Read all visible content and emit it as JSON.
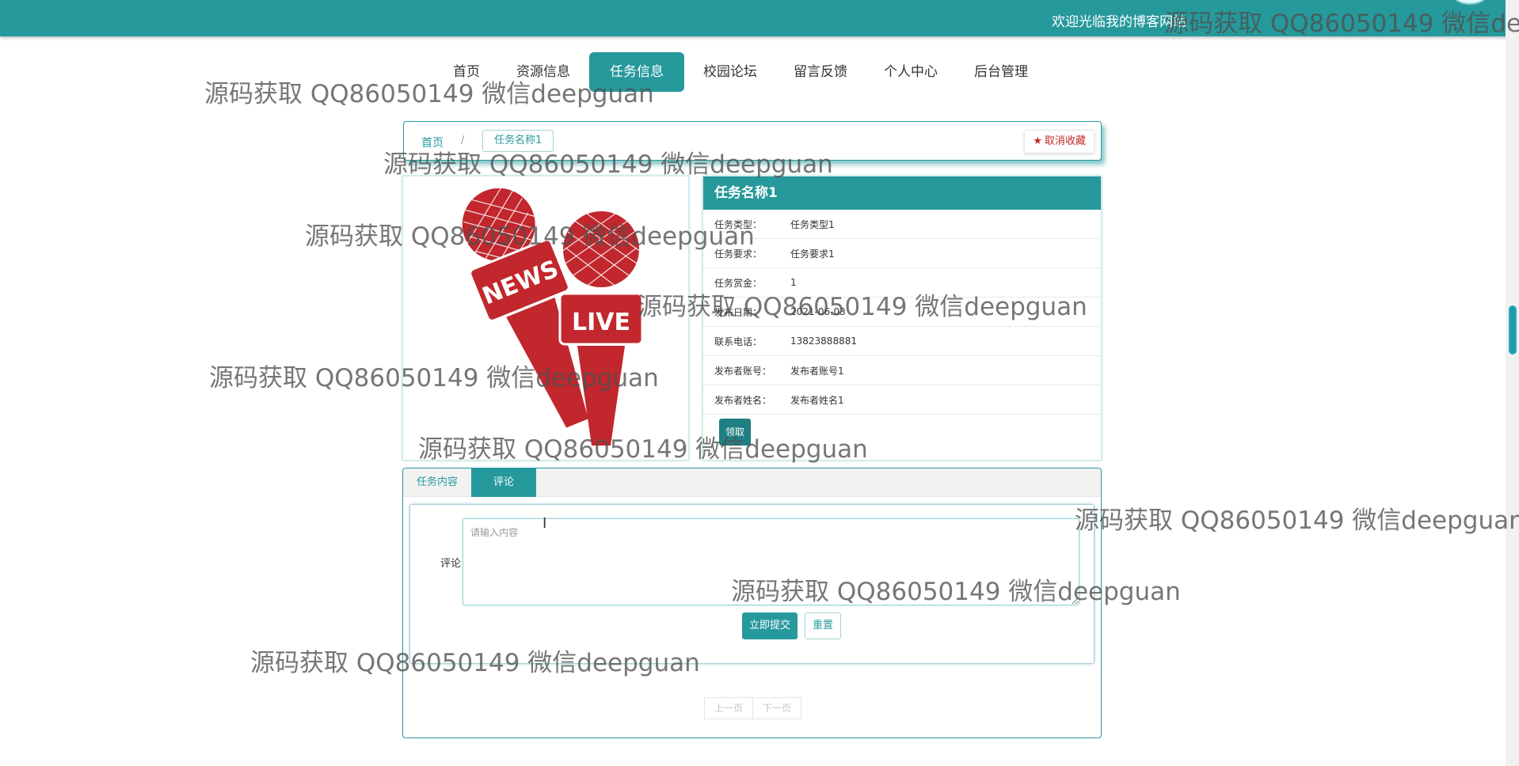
{
  "header": {
    "welcome_text": "欢迎光临我的博客网站"
  },
  "nav": {
    "items": [
      {
        "label": "首页",
        "active": false
      },
      {
        "label": "资源信息",
        "active": false
      },
      {
        "label": "任务信息",
        "active": true
      },
      {
        "label": "校园论坛",
        "active": false
      },
      {
        "label": "留言反馈",
        "active": false
      },
      {
        "label": "个人中心",
        "active": false
      },
      {
        "label": "后台管理",
        "active": false
      }
    ]
  },
  "breadcrumb": {
    "home": "首页",
    "separator": "/",
    "current": "任务名称1"
  },
  "favorite_button": {
    "label": "取消收藏"
  },
  "image": {
    "badge_news": "NEWS",
    "badge_live": "LIVE"
  },
  "task": {
    "title": "任务名称1",
    "fields": [
      {
        "label": "任务类型：",
        "value": "任务类型1"
      },
      {
        "label": "任务要求：",
        "value": "任务要求1"
      },
      {
        "label": "任务赏金：",
        "value": "1"
      },
      {
        "label": "发布日期：",
        "value": "2021-06-03"
      },
      {
        "label": "联系电话：",
        "value": "13823888881"
      },
      {
        "label": "发布者账号：",
        "value": "发布者账号1"
      },
      {
        "label": "发布者姓名：",
        "value": "发布者姓名1"
      }
    ],
    "claim_label": "领取"
  },
  "tabs": {
    "items": [
      {
        "label": "任务内容",
        "active": false
      },
      {
        "label": "评论",
        "active": true
      }
    ]
  },
  "comment": {
    "label": "评论",
    "placeholder": "请输入内容",
    "submit_label": "立即提交",
    "reset_label": "重置"
  },
  "pager": {
    "prev_label": "上一页",
    "next_label": "下一页"
  },
  "watermark": {
    "text": "源码获取 QQ86050149 微信deepguan",
    "text_partial_top": "源码获取 QQ86050149 微信deep"
  },
  "colors": {
    "primary": "#26999c",
    "favorite": "#c0292b",
    "mic_red": "#c1272d"
  }
}
